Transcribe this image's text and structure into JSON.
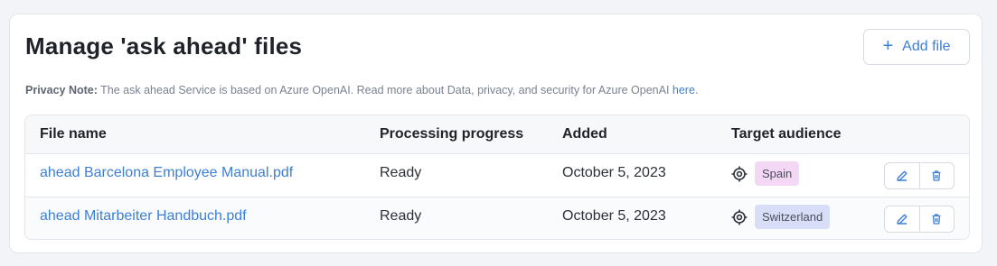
{
  "title": "Manage 'ask ahead' files",
  "add_file_label": "Add file",
  "privacy": {
    "label": "Privacy Note:",
    "text": " The ask ahead Service is based on Azure OpenAI. Read more about Data, privacy, and security for Azure OpenAI ",
    "link": "here",
    "suffix": "."
  },
  "table": {
    "headers": [
      "File name",
      "Processing progress",
      "Added",
      "Target audience"
    ],
    "rows": [
      {
        "file": "ahead Barcelona Employee Manual.pdf",
        "status": "Ready",
        "added": "October 5, 2023",
        "audience": "Spain",
        "audience_color": "#f4d7f5"
      },
      {
        "file": "ahead Mitarbeiter Handbuch.pdf",
        "status": "Ready",
        "added": "October 5, 2023",
        "audience": "Switzerland",
        "audience_color": "#d9def8"
      }
    ]
  },
  "colors": {
    "accent": "#3d7fd4",
    "danger_icon": "#3d7fd4"
  },
  "icons": {
    "add": "plus-icon",
    "audience": "target-icon",
    "edit": "pencil-icon",
    "delete": "trash-icon"
  }
}
